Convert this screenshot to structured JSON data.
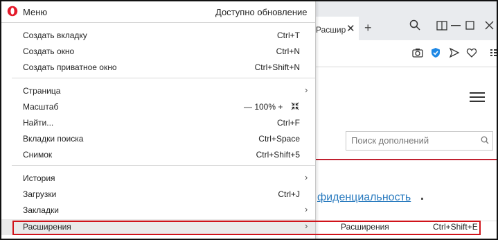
{
  "browser": {
    "tab": {
      "label": "Расшир",
      "close": "✕"
    },
    "new_tab": "+",
    "window_buttons": [
      "🔍",
      "⧉",
      "—",
      "☐",
      "✕"
    ],
    "toolbar_icons": [
      "camera-icon",
      "vpn-shield-icon",
      "send-icon",
      "heart-icon",
      "more-icon"
    ]
  },
  "page": {
    "search_placeholder": "Поиск дополнений",
    "privacy_link": "фиденциальность",
    "accent_color": "#c0202f"
  },
  "menu": {
    "title": "Меню",
    "update": "Доступно обновление",
    "groups": [
      [
        {
          "label": "Создать вкладку",
          "shortcut": "Ctrl+T"
        },
        {
          "label": "Создать окно",
          "shortcut": "Ctrl+N"
        },
        {
          "label": "Создать приватное окно",
          "shortcut": "Ctrl+Shift+N"
        }
      ],
      [
        {
          "label": "Страница",
          "submenu": true
        },
        {
          "label": "Масштаб",
          "zoom": "— 100% +"
        },
        {
          "label": "Найти...",
          "shortcut": "Ctrl+F"
        },
        {
          "label": "Вкладки поиска",
          "shortcut": "Ctrl+Space"
        },
        {
          "label": "Снимок",
          "shortcut": "Ctrl+Shift+5"
        }
      ],
      [
        {
          "label": "История",
          "submenu": true
        },
        {
          "label": "Загрузки",
          "shortcut": "Ctrl+J"
        },
        {
          "label": "Закладки",
          "submenu": true
        },
        {
          "label": "Расширения",
          "submenu": true
        }
      ]
    ]
  },
  "submenu": {
    "item": "Расширения",
    "shortcut": "Ctrl+Shift+E"
  },
  "highlight_color": "#d0131a"
}
